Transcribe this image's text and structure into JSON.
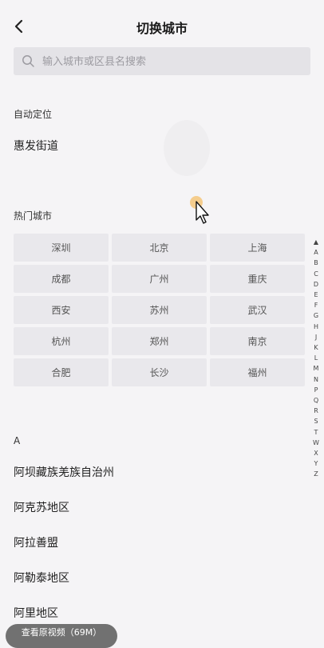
{
  "header": {
    "title": "切换城市"
  },
  "search": {
    "placeholder": "输入城市或区县名搜索"
  },
  "auto_location": {
    "label": "自动定位",
    "value": "惠发街道"
  },
  "hot": {
    "label": "热门城市",
    "cities": [
      "深圳",
      "北京",
      "上海",
      "成都",
      "广州",
      "重庆",
      "西安",
      "苏州",
      "武汉",
      "杭州",
      "郑州",
      "南京",
      "合肥",
      "长沙",
      "福州"
    ]
  },
  "index_letters": [
    "▲",
    "A",
    "B",
    "C",
    "D",
    "E",
    "F",
    "G",
    "H",
    "J",
    "K",
    "L",
    "M",
    "N",
    "P",
    "Q",
    "R",
    "S",
    "T",
    "W",
    "X",
    "Y",
    "Z"
  ],
  "section_a": {
    "letter": "A",
    "items": [
      "阿坝藏族羌族自治州",
      "阿克苏地区",
      "阿拉善盟",
      "阿勒泰地区",
      "阿里地区"
    ]
  },
  "video_pill": {
    "label": "查看原视频（69M）"
  },
  "icons": {
    "back": "back-arrow-icon",
    "search": "search-icon",
    "cursor": "mouse-pointer-icon"
  },
  "colors": {
    "background": "#f5f4f6",
    "search_bg": "#e4e3e7",
    "city_bg": "#e9e8ec",
    "cursor_highlight": "#f4c57a"
  }
}
